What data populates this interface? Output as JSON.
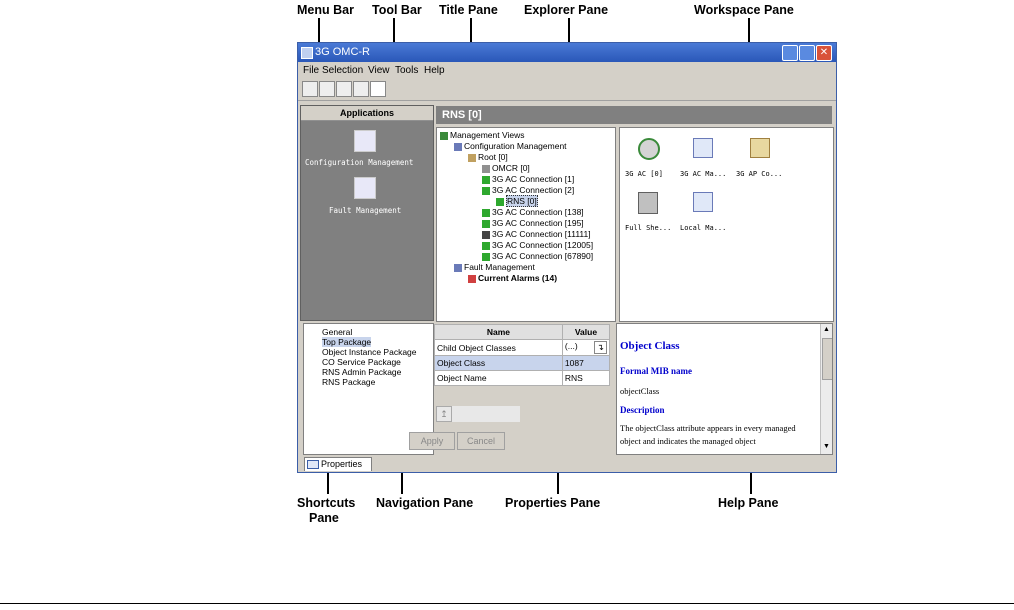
{
  "callouts": {
    "menu_bar": "Menu Bar",
    "tool_bar": "Tool Bar",
    "title_pane": "Title Pane",
    "explorer_pane": "Explorer Pane",
    "workspace_pane": "Workspace Pane",
    "shortcuts_pane_line1": "Shortcuts",
    "shortcuts_pane_line2": "Pane",
    "navigation_pane": "Navigation Pane",
    "properties_pane": "Properties Pane",
    "help_pane": "Help Pane"
  },
  "window": {
    "title": "3G OMC-R",
    "menu": [
      "File",
      "Selection",
      "View",
      "Tools",
      "Help"
    ]
  },
  "applications": {
    "header": "Applications",
    "items": [
      "Configuration Management",
      "Fault Management"
    ]
  },
  "title_pane": {
    "text": "RNS [0]"
  },
  "explorer": {
    "nodes": [
      "Management Views",
      "Configuration Management",
      "Root [0]",
      "OMCR [0]",
      "3G AC Connection [1]",
      "3G AC Connection [2]",
      "RNS [0]",
      "3G AC Connection [138]",
      "3G AC Connection [195]",
      "3G AC Connection [11111]",
      "3G AC Connection [12005]",
      "3G AC Connection [67890]",
      "Fault Management",
      "Current Alarms (14)"
    ]
  },
  "workspace": {
    "items": [
      "3G AC [0]",
      "3G AC Ma...",
      "3G AP Co...",
      "Full She...",
      "Local Ma..."
    ]
  },
  "navigation": {
    "items": [
      "General",
      "Top Package",
      "Object Instance Package",
      "CO Service Package",
      "RNS Admin Package",
      "RNS Package"
    ]
  },
  "properties": {
    "columns": [
      "Name",
      "Value"
    ],
    "rows": [
      {
        "name": "Child Object Classes",
        "value": "(...)"
      },
      {
        "name": "Object Class",
        "value": "1087"
      },
      {
        "name": "Object Name",
        "value": "RNS"
      }
    ],
    "apply_label": "Apply",
    "cancel_label": "Cancel"
  },
  "help": {
    "title": "Object Class",
    "formal_heading": "Formal MIB name",
    "formal_value": "objectClass",
    "desc_heading": "Description",
    "desc_text": "The objectClass attribute appears in every managed object and indicates the managed object"
  },
  "bottom_tab": {
    "label": "Properties"
  },
  "colors": {
    "titlebar": "#2a57b8",
    "title_pane": "#808080",
    "shortcuts_bg": "#808080",
    "help_heading": "#0000cc"
  }
}
